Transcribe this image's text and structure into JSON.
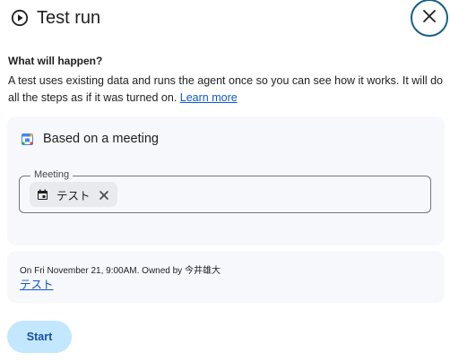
{
  "header": {
    "title": "Test run",
    "icon": "play-circle-icon",
    "close_icon": "close-icon"
  },
  "intro": {
    "heading": "What will happen?",
    "description": "A test uses existing data and runs the agent once so you can see how it works. It will do all the steps as if it was turned on.",
    "learn_more": "Learn more"
  },
  "trigger_card": {
    "icon": "google-calendar-icon",
    "label": "Based on a meeting",
    "field": {
      "legend": "Meeting",
      "chip_icon": "calendar-event-icon",
      "chip_label": "テスト",
      "chip_remove_icon": "close-icon"
    }
  },
  "info_card": {
    "meta": "On Fri November 21, 9:00AM. Owned by 今井雄大",
    "link": "テスト"
  },
  "actions": {
    "start_label": "Start"
  },
  "colors": {
    "accent": "#0b57d0",
    "card_bg": "#f7f8fc",
    "button_bg": "#c2e7ff",
    "close_ring": "#175e8a"
  }
}
